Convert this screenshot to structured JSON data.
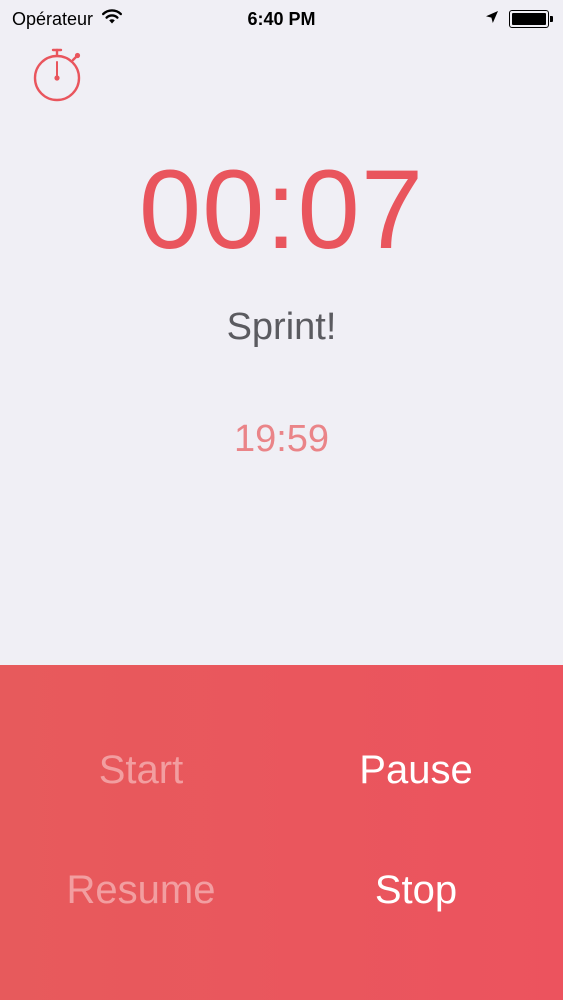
{
  "status_bar": {
    "carrier": "Opérateur",
    "time": "6:40 PM",
    "icons": [
      "wifi-icon",
      "location-arrow-icon",
      "battery-icon"
    ],
    "battery_level": 1.0
  },
  "app_icon": "stopwatch-icon",
  "timer": {
    "elapsed": "00:07",
    "phase": "Sprint!",
    "remaining": "19:59"
  },
  "controls": {
    "start_label": "Start",
    "pause_label": "Pause",
    "resume_label": "Resume",
    "stop_label": "Stop"
  },
  "colors": {
    "accent": "#e9555d",
    "panel": "#eb575d",
    "background": "#f0eff5",
    "phase_text": "#5b5b60",
    "remaining_text": "#ea8488"
  }
}
